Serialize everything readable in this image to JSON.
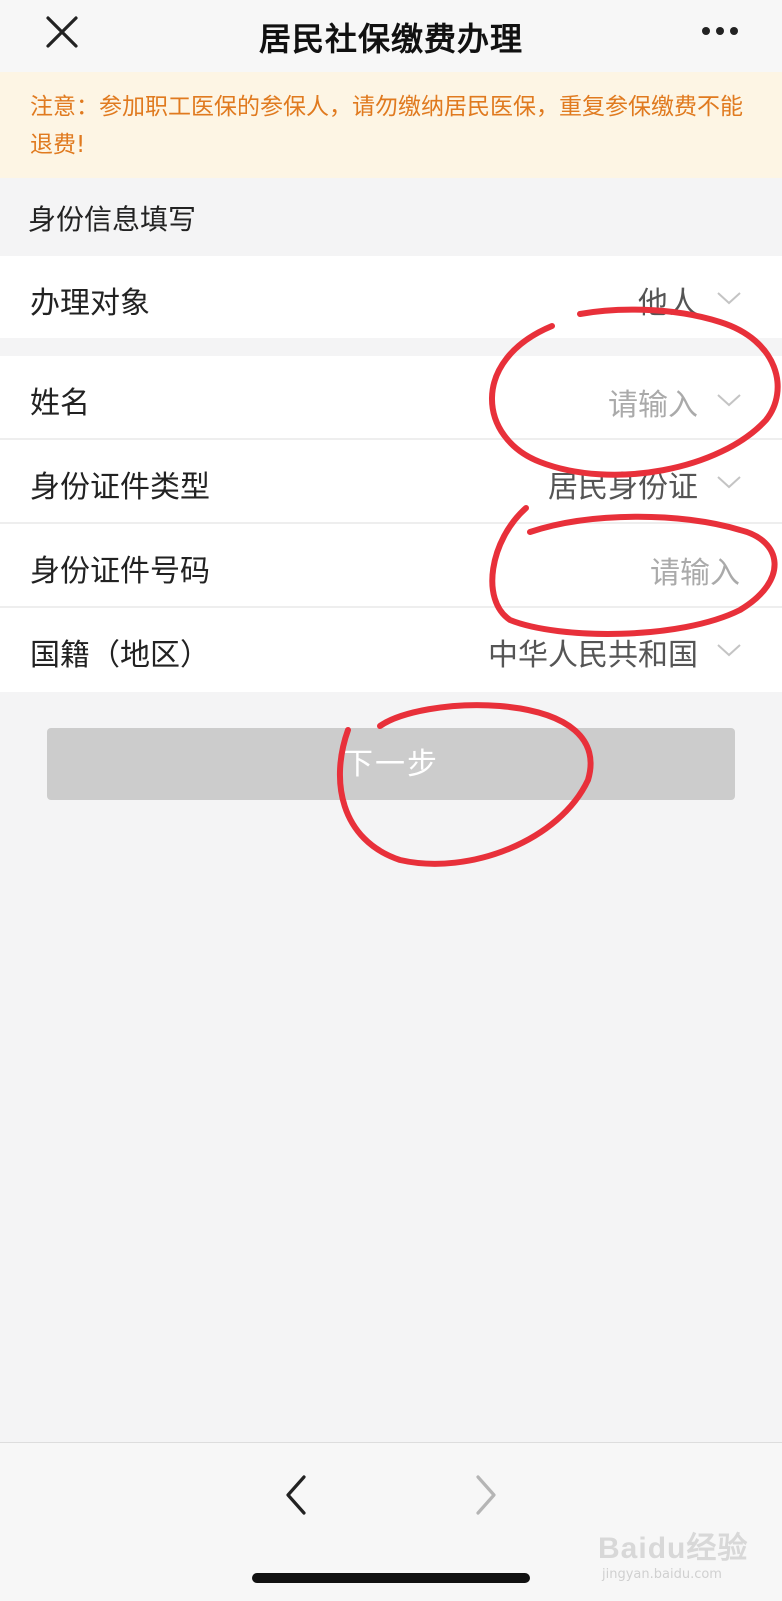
{
  "header": {
    "title": "居民社保缴费办理",
    "close_icon": "close-icon",
    "more_icon": "more-icon"
  },
  "notice": {
    "text": "注意：参加职工医保的参保人，请勿缴纳居民医保，重复参保缴费不能退费!"
  },
  "section": {
    "title": "身份信息填写"
  },
  "form": {
    "subject": {
      "label": "办理对象",
      "value": "他人"
    },
    "name": {
      "label": "姓名",
      "placeholder": "请输入"
    },
    "id_type": {
      "label": "身份证件类型",
      "value": "居民身份证"
    },
    "id_number": {
      "label": "身份证件号码",
      "placeholder": "请输入"
    },
    "nationality": {
      "label": "国籍（地区）",
      "value": "中华人民共和国"
    }
  },
  "next_button": {
    "label": "下一步"
  },
  "bottom_nav": {
    "back_icon": "chevron-left-icon",
    "forward_icon": "chevron-right-icon"
  },
  "watermark": {
    "main": "Bai",
    "main2": "du",
    "cn": "经验",
    "sub": "jingyan.baidu.com"
  },
  "colors": {
    "notice_text": "#e07a1f",
    "notice_bg": "#fdf5e4",
    "annotation": "#e8303a",
    "button_disabled": "#cccccc"
  }
}
